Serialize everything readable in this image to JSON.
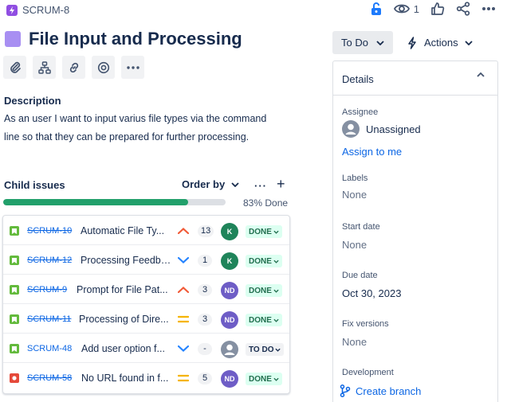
{
  "header": {
    "issue_key": "SCRUM-8",
    "watch_count": "1"
  },
  "issue": {
    "title": "File Input and Processing",
    "description_label": "Description",
    "description": "As an user I want to input varius file types via the command line so that they can be prepared for further processing."
  },
  "child_issues": {
    "title": "Child issues",
    "order_by_label": "Order by",
    "progress_percent": 83,
    "progress_label": "83% Done",
    "items": [
      {
        "type": "story",
        "key": "SCRUM-10",
        "done": true,
        "summary": "Automatic File Ty...",
        "priority": "high",
        "estimate": "13",
        "assignee_initials": "K",
        "assignee_color": "#1f845a",
        "status": "DONE"
      },
      {
        "type": "story",
        "key": "SCRUM-12",
        "done": true,
        "summary": "Processing Feedba...",
        "priority": "low",
        "estimate": "1",
        "assignee_initials": "K",
        "assignee_color": "#1f845a",
        "status": "DONE"
      },
      {
        "type": "story",
        "key": "SCRUM-9",
        "done": true,
        "summary": "Prompt for File Pat...",
        "priority": "high",
        "estimate": "3",
        "assignee_initials": "ND",
        "assignee_color": "#6e5dc6",
        "status": "DONE"
      },
      {
        "type": "story",
        "key": "SCRUM-11",
        "done": true,
        "summary": "Processing of Dire...",
        "priority": "medium",
        "estimate": "3",
        "assignee_initials": "ND",
        "assignee_color": "#6e5dc6",
        "status": "DONE"
      },
      {
        "type": "story",
        "key": "SCRUM-48",
        "done": false,
        "summary": "Add user option f...",
        "priority": "low",
        "estimate": "-",
        "assignee_initials": "",
        "assignee_color": "#8590a2",
        "status": "TO DO"
      },
      {
        "type": "bug",
        "key": "SCRUM-58",
        "done": true,
        "summary": "No URL found in f...",
        "priority": "medium",
        "estimate": "5",
        "assignee_initials": "ND",
        "assignee_color": "#6e5dc6",
        "status": "DONE"
      }
    ]
  },
  "sidebar": {
    "status_label": "To Do",
    "actions_label": "Actions",
    "details_title": "Details",
    "assignee_label": "Assignee",
    "assignee_value": "Unassigned",
    "assign_to_me": "Assign to me",
    "labels_label": "Labels",
    "labels_value": "None",
    "start_date_label": "Start date",
    "start_date_value": "None",
    "due_date_label": "Due date",
    "due_date_value": "Oct 30, 2023",
    "fix_versions_label": "Fix versions",
    "fix_versions_value": "None",
    "development_label": "Development",
    "create_branch": "Create branch"
  },
  "colors": {
    "accent_blue": "#0c66e4",
    "epic_purple": "#904ee2",
    "progress_green": "#22a06b",
    "story_green": "#63ba3c",
    "bug_red": "#e5493a",
    "priority_high": "#f15b38",
    "priority_medium": "#f5b400",
    "priority_low": "#2684ff"
  }
}
